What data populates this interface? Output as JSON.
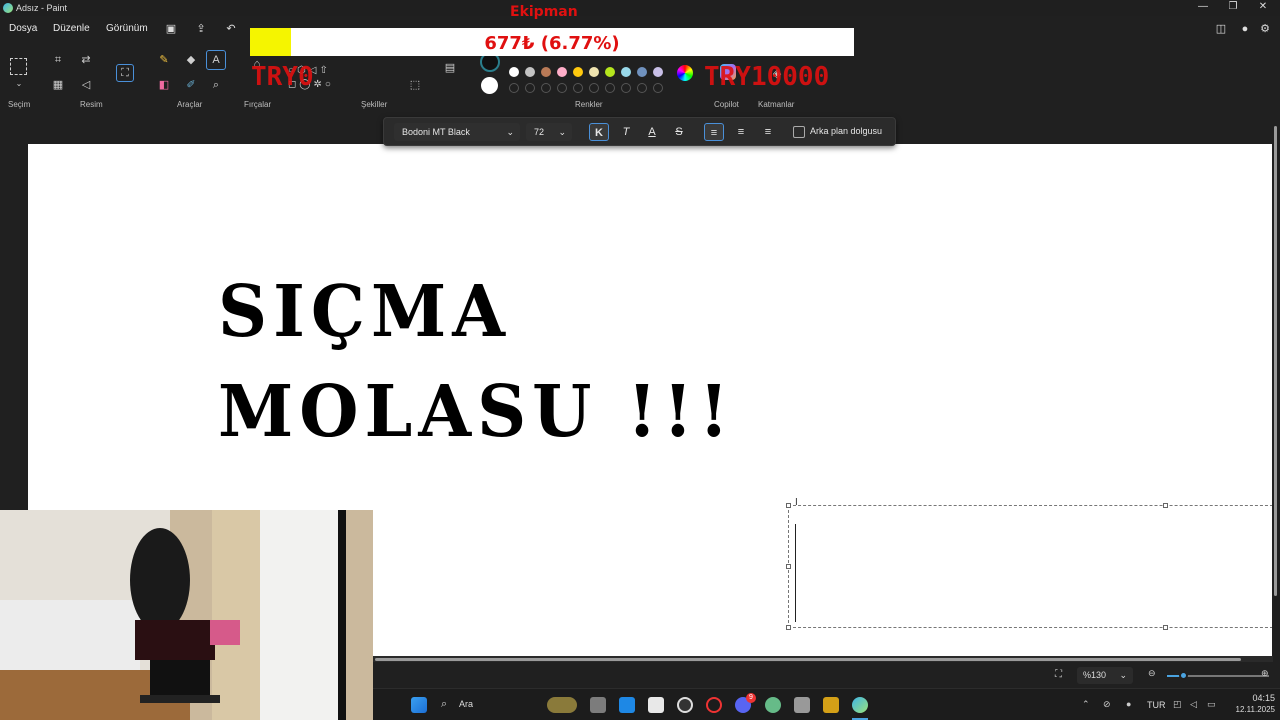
{
  "window": {
    "title": "Adsız - Paint"
  },
  "menu": {
    "file": "Dosya",
    "edit": "Düzenle",
    "view": "Görünüm"
  },
  "ribbon": {
    "groups": {
      "selection": "Seçim",
      "image": "Resim",
      "tools": "Araçlar",
      "brushes": "Fırçalar",
      "shapes": "Şekiller",
      "colors": "Renkler",
      "copilot": "Copilot",
      "layers": "Katmanlar"
    },
    "palette": [
      "#ffffff",
      "#c3c3c3",
      "#b97a57",
      "#ffaec9",
      "#ffc90e",
      "#efe4b0",
      "#b5e61d",
      "#99d9ea",
      "#7092be",
      "#c8bfe7"
    ]
  },
  "text_toolbar": {
    "font": "Bodoni MT Black",
    "size": "72",
    "bold": "K",
    "italic": "T",
    "underline": "A",
    "strike": "S",
    "background_fill": "Arka plan dolgusu"
  },
  "canvas": {
    "line1": "SIÇMA",
    "line2": "MOLASU !!!"
  },
  "overlay": {
    "donor_name": "Ekipman",
    "goal_text": "677₺ (6.77%)",
    "goal_fraction": 0.0677,
    "min_label": "TRY0",
    "max_label": "TRY10000"
  },
  "statusbar": {
    "zoom": "%130"
  },
  "taskbar": {
    "search": "Ara",
    "language": "TUR",
    "time": "04:15",
    "date": "12.11.2025",
    "discord_badge": "9"
  }
}
